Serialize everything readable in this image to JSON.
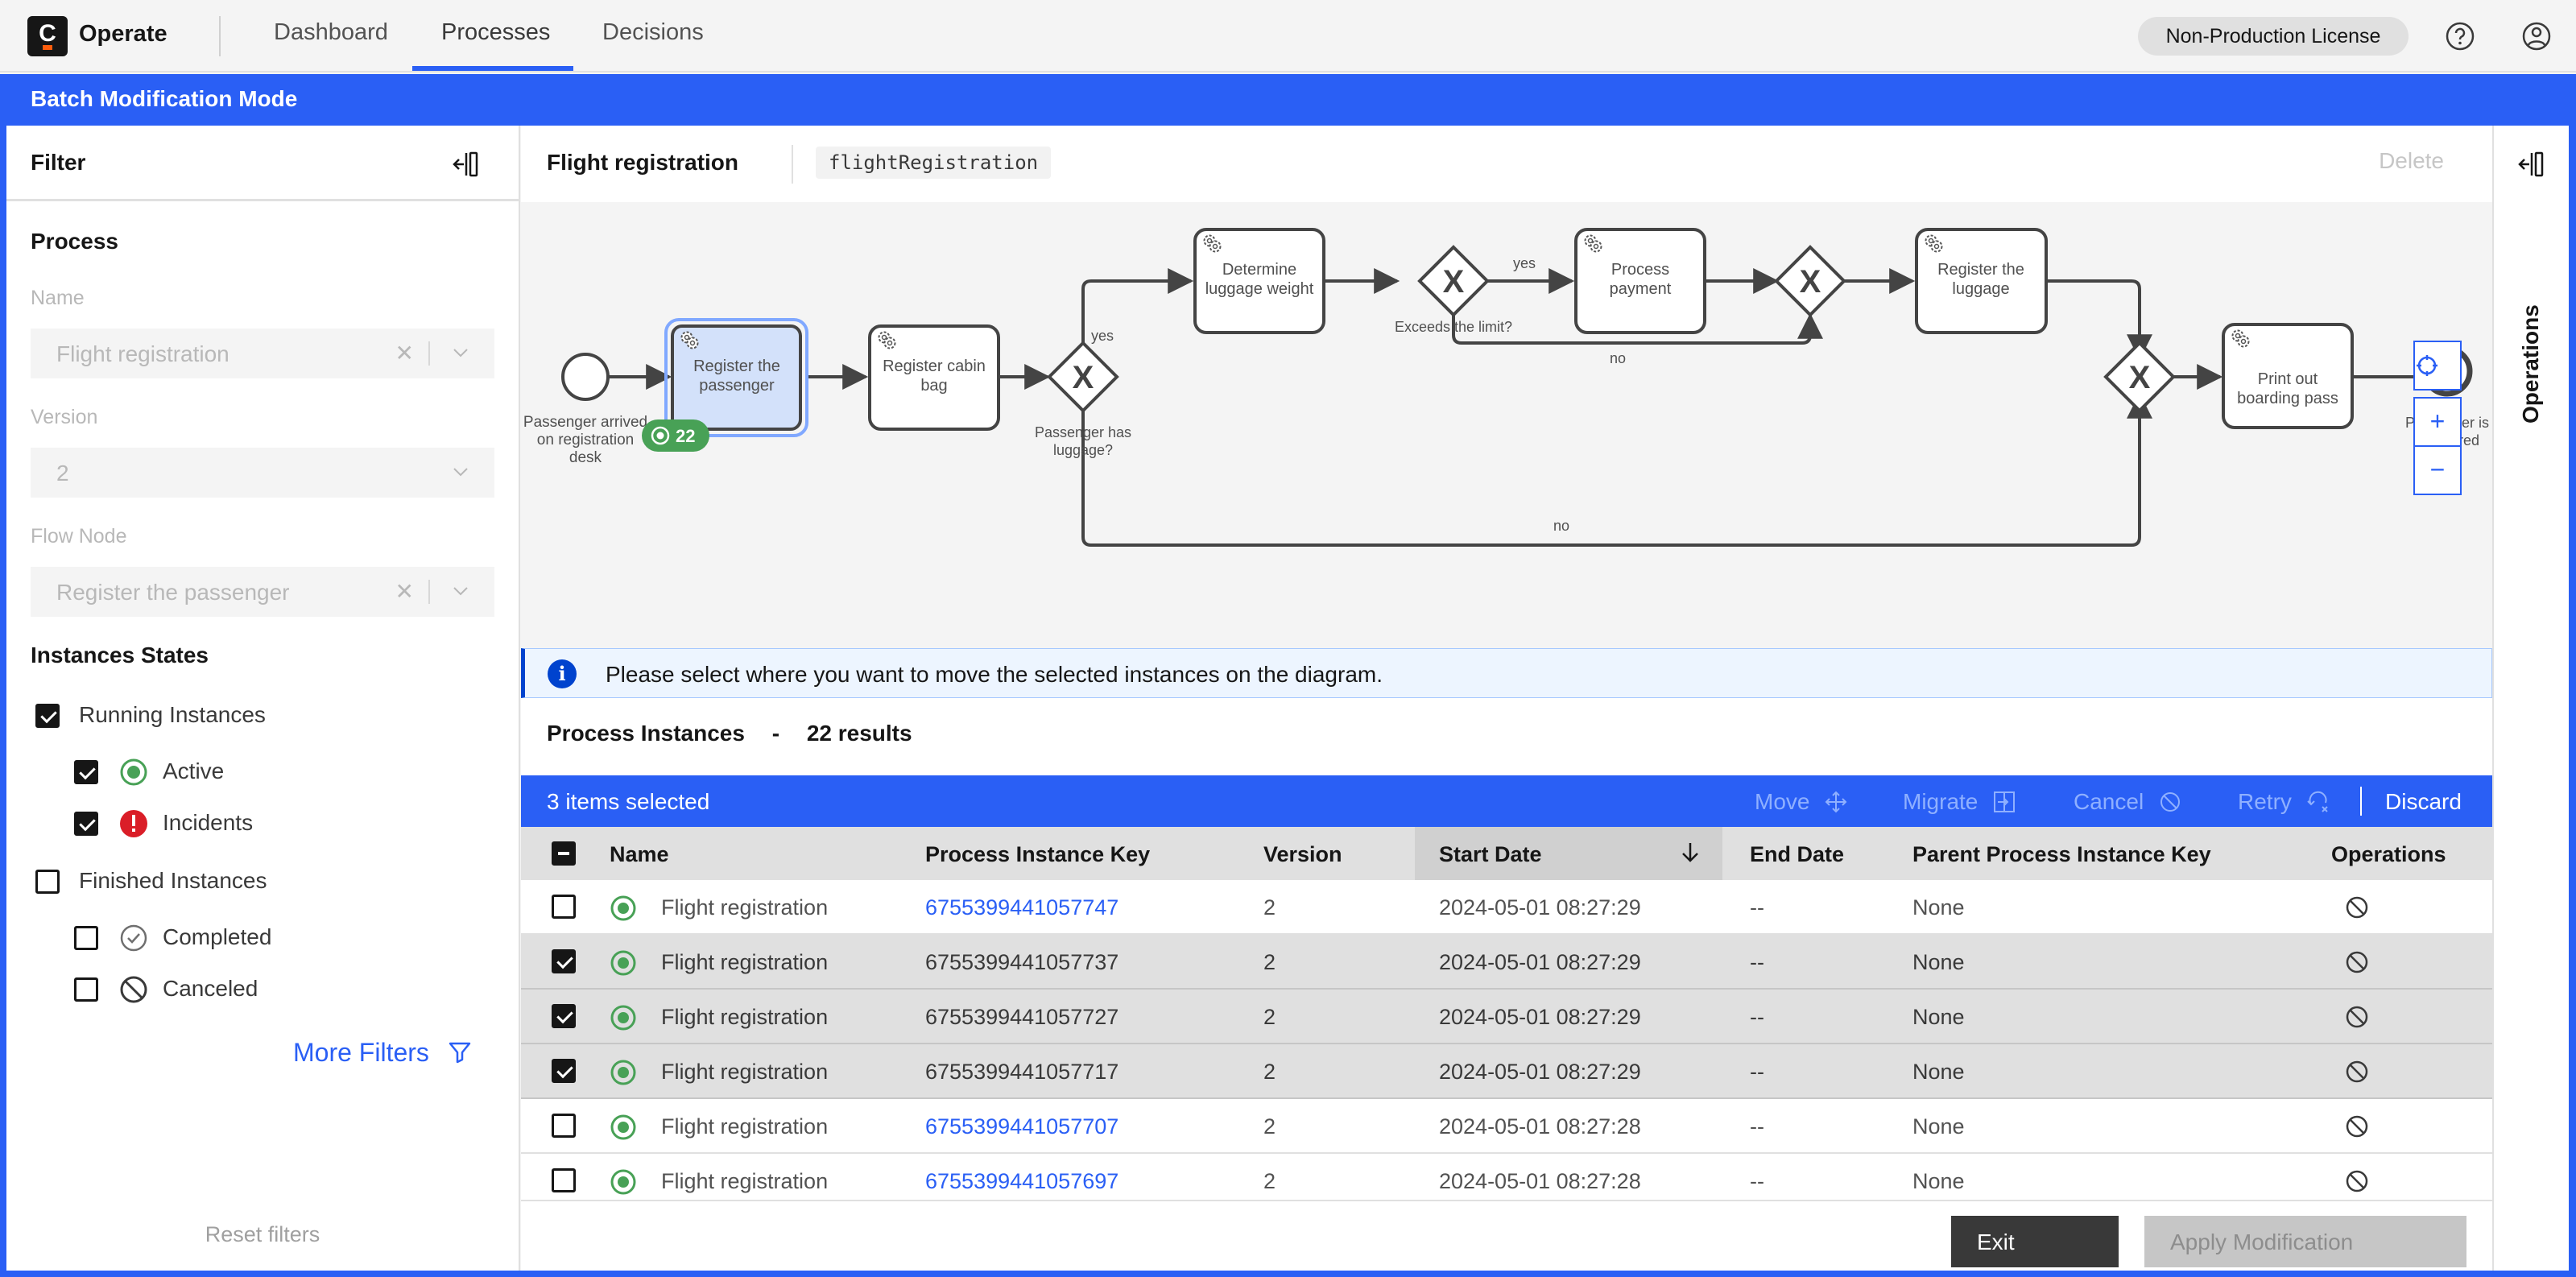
{
  "header": {
    "logo_letter": "C",
    "app_name": "Operate",
    "nav": [
      {
        "label": "Dashboard",
        "active": false
      },
      {
        "label": "Processes",
        "active": true
      },
      {
        "label": "Decisions",
        "active": false
      }
    ],
    "license": "Non-Production License",
    "icons": {
      "help": "help-icon",
      "user": "user-avatar-icon"
    }
  },
  "batch_mode": {
    "title": "Batch Modification Mode",
    "accent": "#2a5ff5"
  },
  "filter": {
    "title": "Filter",
    "process_section": "Process",
    "name_label": "Name",
    "name_value": "Flight registration",
    "version_label": "Version",
    "version_value": "2",
    "flow_node_label": "Flow Node",
    "flow_node_value": "Register the passenger",
    "states_section": "Instances States",
    "running": {
      "label": "Running Instances",
      "checked": true
    },
    "active": {
      "label": "Active",
      "checked": true
    },
    "incidents": {
      "label": "Incidents",
      "checked": true
    },
    "finished": {
      "label": "Finished Instances",
      "checked": false
    },
    "completed": {
      "label": "Completed",
      "checked": false
    },
    "canceled": {
      "label": "Canceled",
      "checked": false
    },
    "more_filters": "More Filters",
    "reset_filters": "Reset filters"
  },
  "process": {
    "name": "Flight registration",
    "id": "flightRegistration",
    "delete_label": "Delete"
  },
  "diagram": {
    "start_event": "Passenger arrived on registration desk",
    "tasks": {
      "register_passenger": "Register the passenger",
      "register_cabin_bag": "Register cabin bag",
      "determine_weight": "Determine luggage weight",
      "process_payment": "Process payment",
      "register_luggage": "Register the luggage",
      "print_boarding_pass": "Print out boarding pass"
    },
    "gateways": {
      "has_luggage": "Passenger has luggage?",
      "exceeds_limit": "Exceeds the limit?"
    },
    "end_event": "Passenger is registered",
    "flow_labels": {
      "yes1": "yes",
      "yes2": "yes",
      "no1": "no",
      "no2": "no"
    },
    "active_badge_count": "22",
    "zoom_controls": {
      "reset": "reset-zoom-icon",
      "in": "+",
      "out": "−"
    }
  },
  "info_banner": "Please select where you want to move the selected instances on the diagram.",
  "instances": {
    "title": "Process Instances",
    "separator": "-",
    "count_text": "22 results",
    "selection": {
      "count_text": "3 items selected",
      "actions": [
        "Move",
        "Migrate",
        "Cancel",
        "Retry"
      ],
      "discard": "Discard"
    },
    "columns": [
      "Name",
      "Process Instance Key",
      "Version",
      "Start Date",
      "End Date",
      "Parent Process Instance Key",
      "Operations"
    ],
    "sort": {
      "column": "Start Date",
      "direction": "descending"
    },
    "rows": [
      {
        "selected": false,
        "name": "Flight registration",
        "key": "6755399441057747",
        "version": "2",
        "start": "2024-05-01 08:27:29",
        "end": "--",
        "parent": "None"
      },
      {
        "selected": true,
        "name": "Flight registration",
        "key": "6755399441057737",
        "version": "2",
        "start": "2024-05-01 08:27:29",
        "end": "--",
        "parent": "None"
      },
      {
        "selected": true,
        "name": "Flight registration",
        "key": "6755399441057727",
        "version": "2",
        "start": "2024-05-01 08:27:29",
        "end": "--",
        "parent": "None"
      },
      {
        "selected": true,
        "name": "Flight registration",
        "key": "6755399441057717",
        "version": "2",
        "start": "2024-05-01 08:27:29",
        "end": "--",
        "parent": "None"
      },
      {
        "selected": false,
        "name": "Flight registration",
        "key": "6755399441057707",
        "version": "2",
        "start": "2024-05-01 08:27:28",
        "end": "--",
        "parent": "None"
      },
      {
        "selected": false,
        "name": "Flight registration",
        "key": "6755399441057697",
        "version": "2",
        "start": "2024-05-01 08:27:28",
        "end": "--",
        "parent": "None"
      }
    ]
  },
  "footer": {
    "exit": "Exit",
    "apply": "Apply Modification"
  },
  "operations_panel": {
    "label": "Operations"
  }
}
